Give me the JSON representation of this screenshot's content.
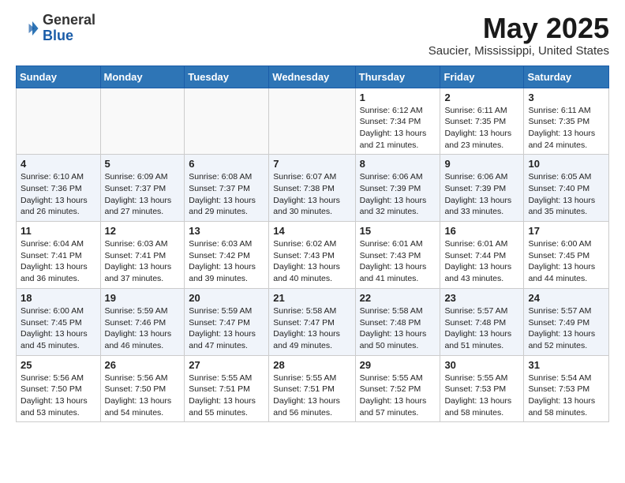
{
  "header": {
    "logo_general": "General",
    "logo_blue": "Blue",
    "main_title": "May 2025",
    "subtitle": "Saucier, Mississippi, United States"
  },
  "days_of_week": [
    "Sunday",
    "Monday",
    "Tuesday",
    "Wednesday",
    "Thursday",
    "Friday",
    "Saturday"
  ],
  "weeks": [
    [
      {
        "day": "",
        "info": ""
      },
      {
        "day": "",
        "info": ""
      },
      {
        "day": "",
        "info": ""
      },
      {
        "day": "",
        "info": ""
      },
      {
        "day": "1",
        "info": "Sunrise: 6:12 AM\nSunset: 7:34 PM\nDaylight: 13 hours and 21 minutes."
      },
      {
        "day": "2",
        "info": "Sunrise: 6:11 AM\nSunset: 7:35 PM\nDaylight: 13 hours and 23 minutes."
      },
      {
        "day": "3",
        "info": "Sunrise: 6:11 AM\nSunset: 7:35 PM\nDaylight: 13 hours and 24 minutes."
      }
    ],
    [
      {
        "day": "4",
        "info": "Sunrise: 6:10 AM\nSunset: 7:36 PM\nDaylight: 13 hours and 26 minutes."
      },
      {
        "day": "5",
        "info": "Sunrise: 6:09 AM\nSunset: 7:37 PM\nDaylight: 13 hours and 27 minutes."
      },
      {
        "day": "6",
        "info": "Sunrise: 6:08 AM\nSunset: 7:37 PM\nDaylight: 13 hours and 29 minutes."
      },
      {
        "day": "7",
        "info": "Sunrise: 6:07 AM\nSunset: 7:38 PM\nDaylight: 13 hours and 30 minutes."
      },
      {
        "day": "8",
        "info": "Sunrise: 6:06 AM\nSunset: 7:39 PM\nDaylight: 13 hours and 32 minutes."
      },
      {
        "day": "9",
        "info": "Sunrise: 6:06 AM\nSunset: 7:39 PM\nDaylight: 13 hours and 33 minutes."
      },
      {
        "day": "10",
        "info": "Sunrise: 6:05 AM\nSunset: 7:40 PM\nDaylight: 13 hours and 35 minutes."
      }
    ],
    [
      {
        "day": "11",
        "info": "Sunrise: 6:04 AM\nSunset: 7:41 PM\nDaylight: 13 hours and 36 minutes."
      },
      {
        "day": "12",
        "info": "Sunrise: 6:03 AM\nSunset: 7:41 PM\nDaylight: 13 hours and 37 minutes."
      },
      {
        "day": "13",
        "info": "Sunrise: 6:03 AM\nSunset: 7:42 PM\nDaylight: 13 hours and 39 minutes."
      },
      {
        "day": "14",
        "info": "Sunrise: 6:02 AM\nSunset: 7:43 PM\nDaylight: 13 hours and 40 minutes."
      },
      {
        "day": "15",
        "info": "Sunrise: 6:01 AM\nSunset: 7:43 PM\nDaylight: 13 hours and 41 minutes."
      },
      {
        "day": "16",
        "info": "Sunrise: 6:01 AM\nSunset: 7:44 PM\nDaylight: 13 hours and 43 minutes."
      },
      {
        "day": "17",
        "info": "Sunrise: 6:00 AM\nSunset: 7:45 PM\nDaylight: 13 hours and 44 minutes."
      }
    ],
    [
      {
        "day": "18",
        "info": "Sunrise: 6:00 AM\nSunset: 7:45 PM\nDaylight: 13 hours and 45 minutes."
      },
      {
        "day": "19",
        "info": "Sunrise: 5:59 AM\nSunset: 7:46 PM\nDaylight: 13 hours and 46 minutes."
      },
      {
        "day": "20",
        "info": "Sunrise: 5:59 AM\nSunset: 7:47 PM\nDaylight: 13 hours and 47 minutes."
      },
      {
        "day": "21",
        "info": "Sunrise: 5:58 AM\nSunset: 7:47 PM\nDaylight: 13 hours and 49 minutes."
      },
      {
        "day": "22",
        "info": "Sunrise: 5:58 AM\nSunset: 7:48 PM\nDaylight: 13 hours and 50 minutes."
      },
      {
        "day": "23",
        "info": "Sunrise: 5:57 AM\nSunset: 7:48 PM\nDaylight: 13 hours and 51 minutes."
      },
      {
        "day": "24",
        "info": "Sunrise: 5:57 AM\nSunset: 7:49 PM\nDaylight: 13 hours and 52 minutes."
      }
    ],
    [
      {
        "day": "25",
        "info": "Sunrise: 5:56 AM\nSunset: 7:50 PM\nDaylight: 13 hours and 53 minutes."
      },
      {
        "day": "26",
        "info": "Sunrise: 5:56 AM\nSunset: 7:50 PM\nDaylight: 13 hours and 54 minutes."
      },
      {
        "day": "27",
        "info": "Sunrise: 5:55 AM\nSunset: 7:51 PM\nDaylight: 13 hours and 55 minutes."
      },
      {
        "day": "28",
        "info": "Sunrise: 5:55 AM\nSunset: 7:51 PM\nDaylight: 13 hours and 56 minutes."
      },
      {
        "day": "29",
        "info": "Sunrise: 5:55 AM\nSunset: 7:52 PM\nDaylight: 13 hours and 57 minutes."
      },
      {
        "day": "30",
        "info": "Sunrise: 5:55 AM\nSunset: 7:53 PM\nDaylight: 13 hours and 58 minutes."
      },
      {
        "day": "31",
        "info": "Sunrise: 5:54 AM\nSunset: 7:53 PM\nDaylight: 13 hours and 58 minutes."
      }
    ]
  ]
}
